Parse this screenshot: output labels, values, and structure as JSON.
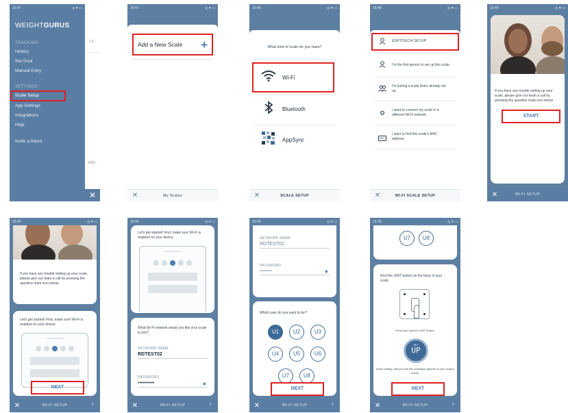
{
  "status": {
    "p1": "16:47",
    "p2": "16:47",
    "p3": "16:48",
    "p4": "16:48",
    "p5": "16:49",
    "p6": "16:49",
    "p7": "16:49",
    "p8": "16:49",
    "p9": "16:49",
    "signal": "3il",
    "network": "HD",
    "right": "◎ ♥ ▭"
  },
  "menu": {
    "logo_left": "WEIGHT",
    "logo_right": "GURUS",
    "section_tracking": "TRACKING",
    "history": "History",
    "set_goal": "Set Goal",
    "manual_entry": "Manual Entry",
    "section_settings": "SETTINGS",
    "scale_setup": "Scale Setup",
    "app_settings": "App Settings",
    "integrations": "Integrations",
    "help": "Help",
    "invite": "Invite a friend",
    "under_cu": "CU",
    "under_wee": "WEE"
  },
  "scales": {
    "add_label": "Add a New Scale",
    "footer_title": "My Scales"
  },
  "scale_type": {
    "question": "What kind of scale do you have?",
    "wifi": "Wi-Fi",
    "bluetooth": "Bluetooth",
    "appsync": "AppSync",
    "footer_title": "SCALE SETUP"
  },
  "wifi_setup": {
    "esptouch": "ESPTOUCH SETUP",
    "first_person": "I'm the first person to set up this scale.",
    "joining": "I'm joining a scale that's already set up.",
    "connect_new": "I want to connect my scale to a different Wi-Fi network.",
    "find_mac": "I want to find this scale's MAC address.",
    "mac_icon": "MAC",
    "footer_title": "WI-FI SCALE SETUP"
  },
  "intro": {
    "trouble": "If you have any trouble setting up your scale, please give our team a call by pressing the question mark icon below.",
    "start": "START",
    "footer_title": "WI-FI SETUP"
  },
  "step": {
    "lets_start": "Let's get started! First, make sure Wi-Fi is enabled on your device.",
    "next": "NEXT",
    "network_question": "What Wi-Fi network would you like your scale to join?",
    "network_name_label": "NETWORK NAME",
    "network_name": "RDTEST02",
    "password_label": "PASSWORD",
    "password_mask": "••••••••••",
    "user_question": "Which user do you want to be?",
    "users": [
      "U1",
      "U2",
      "U3",
      "U4",
      "U5",
      "U6",
      "U7",
      "U8"
    ],
    "unit_find": "Find the UNIT button on the back of your scale.",
    "press_hold": "Press and hold the UNIT button.",
    "keep_holding": "Keep holding until you see this animation appear on your scale's screen.",
    "display_small": "SET",
    "display_big": "UP"
  },
  "colors": {
    "accent": "#5a7ea3",
    "highlight": "#e02020",
    "link": "#4e7db0"
  }
}
